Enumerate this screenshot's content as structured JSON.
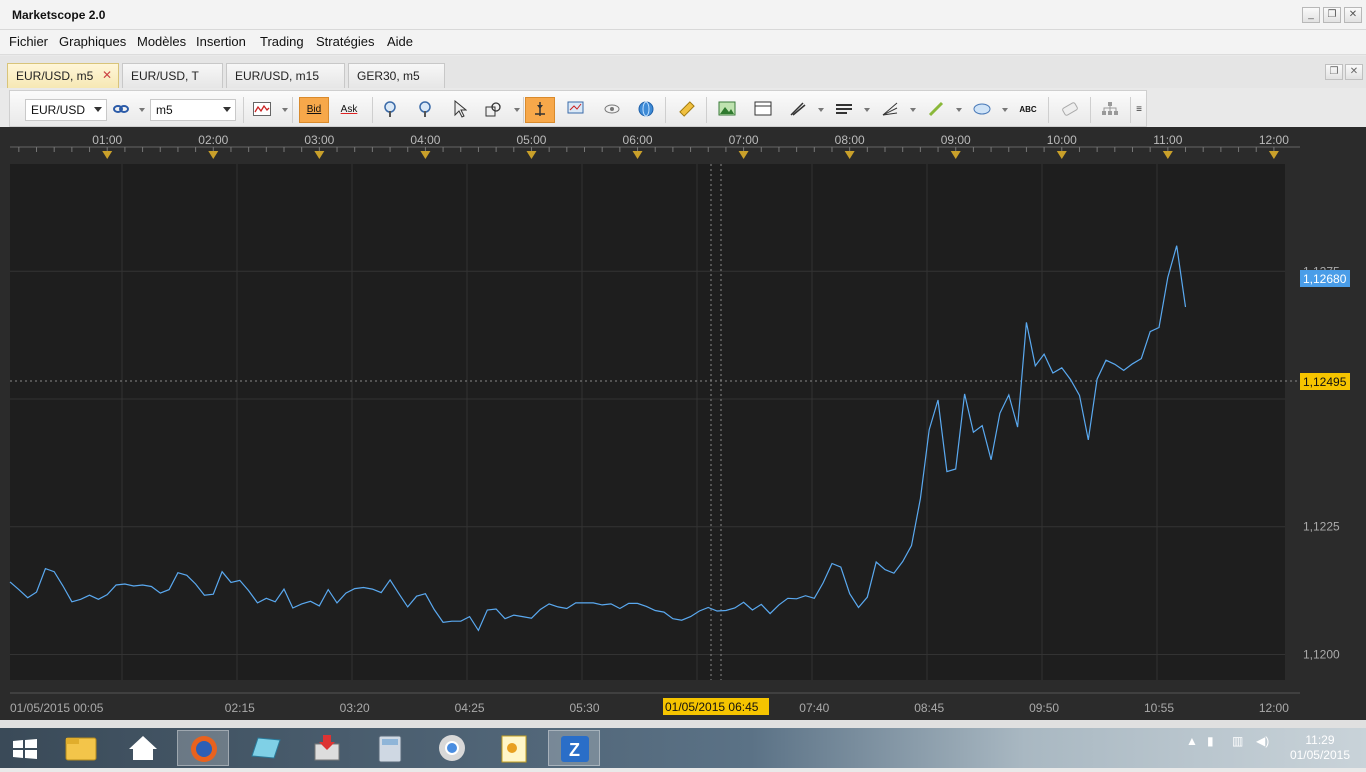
{
  "window": {
    "title": "Marketscope 2.0",
    "controls": [
      "minimize",
      "restore",
      "close"
    ]
  },
  "menu": {
    "items": [
      "Fichier",
      "Graphiques",
      "Modèles",
      "Insertion",
      "Trading",
      "Stratégies",
      "Aide"
    ]
  },
  "tabs": [
    {
      "label": "EUR/USD, m5",
      "active": true,
      "closable": true
    },
    {
      "label": "EUR/USD, T",
      "active": false
    },
    {
      "label": "EUR/USD, m15",
      "active": false
    },
    {
      "label": "GER30, m5",
      "active": false
    }
  ],
  "toolbar": {
    "instrument": "EUR/USD",
    "timeframe": "m5",
    "bid_label": "Bid",
    "ask_label": "Ask",
    "abc_label": "ABC",
    "bid_active": true
  },
  "chart": {
    "top_time_labels": [
      "01:00",
      "02:00",
      "03:00",
      "04:00",
      "05:00",
      "06:00",
      "07:00",
      "08:00",
      "09:00",
      "10:00",
      "11:00",
      "12:00"
    ],
    "bottom_time_labels": [
      "01/05/2015 00:05",
      "02:15",
      "03:20",
      "04:25",
      "05:30",
      "01/05/2015 06:45",
      "07:40",
      "08:45",
      "09:50",
      "10:55",
      "12:00"
    ],
    "y_labels": [
      "1,1275",
      "1,1225",
      "1,1200"
    ],
    "current_price_label": "1,12680",
    "crosshair_price_label": "1,12495",
    "crosshair_time_label": "01/05/2015 06:45",
    "colors": {
      "background": "#1e1e1e",
      "line": "#5aa9f0",
      "current_price": "#4a9de8",
      "crosshair_tag": "#f5c400",
      "marker": "#c9a02a"
    }
  },
  "chart_data": {
    "type": "line",
    "title": "",
    "xlabel": "",
    "ylabel": "",
    "x_start": "00:05",
    "x_interval_minutes": 5,
    "ylim": [
      1.1195,
      1.1296
    ],
    "series": [
      {
        "values": [
          1.12142,
          1.12127,
          1.12111,
          1.12122,
          1.12168,
          1.12162,
          1.12134,
          1.12103,
          1.12108,
          1.12116,
          1.12108,
          1.12117,
          1.12136,
          1.12138,
          1.12134,
          1.12136,
          1.12133,
          1.1212,
          1.12127,
          1.1216,
          1.12155,
          1.12138,
          1.12116,
          1.12118,
          1.12162,
          1.12141,
          1.12145,
          1.12125,
          1.12101,
          1.1211,
          1.12103,
          1.12128,
          1.12091,
          1.12099,
          1.12104,
          1.12095,
          1.12127,
          1.12101,
          1.1212,
          1.12129,
          1.12131,
          1.12128,
          1.12121,
          1.12146,
          1.12119,
          1.12093,
          1.12114,
          1.12119,
          1.12088,
          1.12063,
          1.12065,
          1.12065,
          1.12074,
          1.12047,
          1.12087,
          1.12089,
          1.1207,
          1.12077,
          1.12074,
          1.12071,
          1.12088,
          1.12099,
          1.12093,
          1.1209,
          1.12101,
          1.12101,
          1.12101,
          1.12097,
          1.12099,
          1.1209,
          1.121,
          1.121,
          1.12094,
          1.12086,
          1.12083,
          1.1207,
          1.12067,
          1.12074,
          1.12085,
          1.12092,
          1.12085,
          1.12086,
          1.12091,
          1.12102,
          1.12087,
          1.12098,
          1.1208,
          1.12097,
          1.1211,
          1.12109,
          1.12115,
          1.1211,
          1.1214,
          1.12178,
          1.12171,
          1.12119,
          1.12092,
          1.12112,
          1.12181,
          1.12166,
          1.12159,
          1.12182,
          1.12213,
          1.12305,
          1.1244,
          1.12498,
          1.12358,
          1.12363,
          1.1251,
          1.12435,
          1.12448,
          1.12381,
          1.12472,
          1.12508,
          1.12445,
          1.1265,
          1.12565,
          1.12588,
          1.12551,
          1.12561,
          1.12538,
          1.12507,
          1.1242,
          1.12539,
          1.12576,
          1.12568,
          1.12556,
          1.12569,
          1.12579,
          1.12632,
          1.1264,
          1.12738,
          1.128,
          1.1268
        ]
      }
    ]
  },
  "taskbar": {
    "apps": [
      "start-icon",
      "file-explorer-icon",
      "home-icon",
      "firefox-icon",
      "notes-icon",
      "installer-icon",
      "calculator-icon",
      "chrome-icon",
      "image-viewer-icon",
      "marketscope-icon"
    ],
    "time": "11:29",
    "date": "01/05/2015"
  }
}
